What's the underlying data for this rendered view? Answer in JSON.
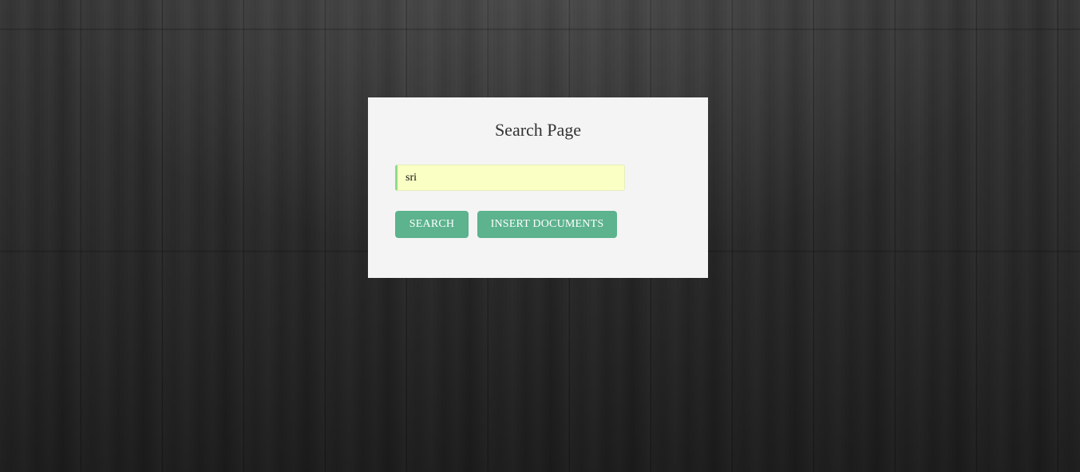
{
  "page": {
    "title": "Search Page"
  },
  "search": {
    "value": "sri",
    "placeholder": ""
  },
  "buttons": {
    "search_label": "SEARCH",
    "insert_label": "INSERT DOCUMENTS"
  },
  "colors": {
    "button_bg": "#5cb38d",
    "input_bg": "#faffc4",
    "input_accent": "#8fdc88",
    "card_bg": "#f4f4f4"
  }
}
